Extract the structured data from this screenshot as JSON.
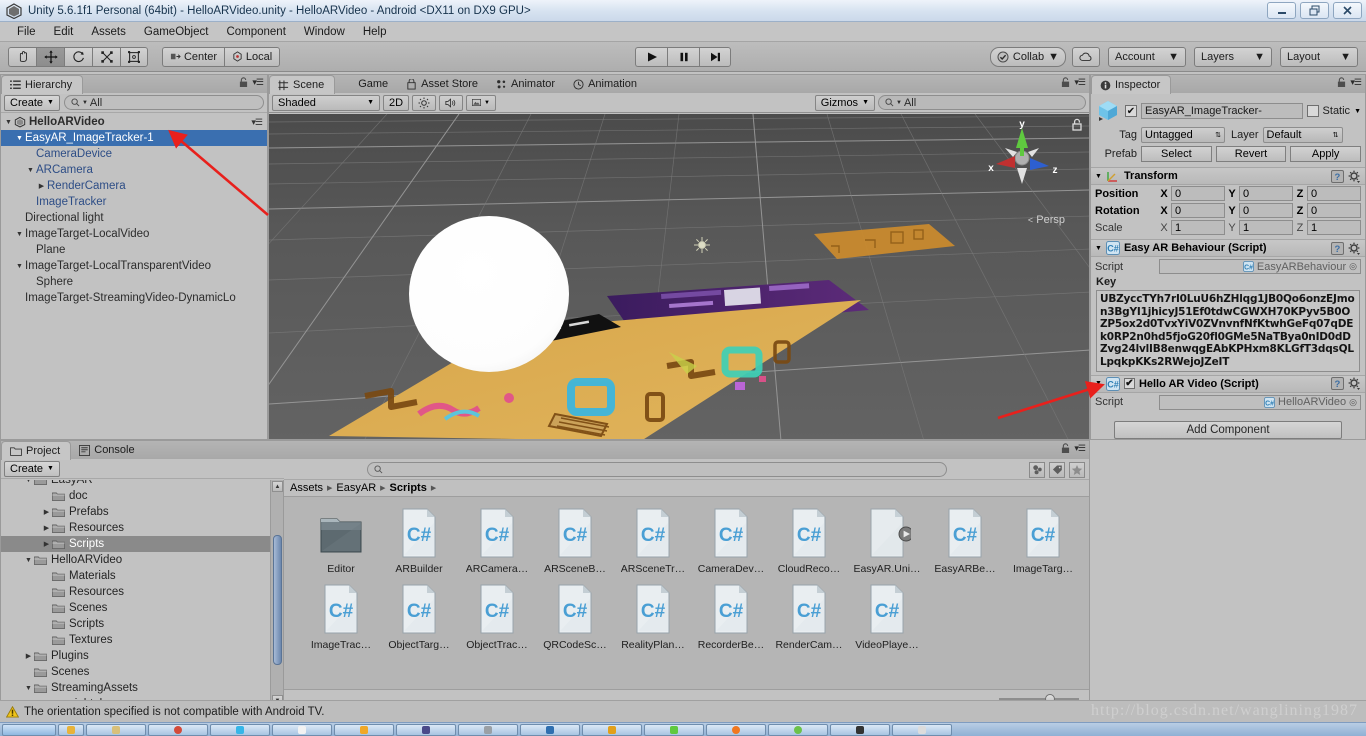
{
  "window": {
    "title": "Unity 5.6.1f1 Personal (64bit) - HelloARVideo.unity - HelloARVideo - Android <DX11 on DX9 GPU>",
    "app_icon": "unity-logo-icon",
    "minimize": "–",
    "restore": "❐",
    "close": "✕"
  },
  "menubar": {
    "items": [
      "File",
      "Edit",
      "Assets",
      "GameObject",
      "Component",
      "Window",
      "Help"
    ]
  },
  "toolbar": {
    "tools": [
      {
        "name": "hand-tool",
        "glyph": "✋",
        "active": false
      },
      {
        "name": "move-tool",
        "glyph": "✥",
        "active": true
      },
      {
        "name": "rotate-tool",
        "glyph": "↻",
        "active": false
      },
      {
        "name": "scale-tool",
        "glyph": "⤢",
        "active": false
      },
      {
        "name": "rect-tool",
        "glyph": "⧉",
        "active": false
      }
    ],
    "pivot_mode": "Center",
    "pivot_rotation": "Local",
    "play": "▶",
    "pause": "❙❙",
    "step": "▶❙",
    "collab": "Collab",
    "cloud_icon": "cloud-icon",
    "account": "Account",
    "layers": "Layers",
    "layout": "Layout"
  },
  "hierarchy": {
    "tab": "Hierarchy",
    "tab_icon": "hierarchy-icon",
    "create": "Create",
    "search_placeholder": "All",
    "search_value": "",
    "rows": [
      {
        "label": "HelloARVideo",
        "depth": 0,
        "arrow": "down",
        "scene": true,
        "selected": false,
        "style": "bold"
      },
      {
        "label": "EasyAR_ImageTracker-1",
        "depth": 1,
        "arrow": "down",
        "scene": false,
        "selected": true,
        "style": "prefab"
      },
      {
        "label": "CameraDevice",
        "depth": 2,
        "arrow": "none",
        "scene": false,
        "selected": false,
        "style": "prefab"
      },
      {
        "label": "ARCamera",
        "depth": 2,
        "arrow": "down",
        "scene": false,
        "selected": false,
        "style": "prefab"
      },
      {
        "label": "RenderCamera",
        "depth": 3,
        "arrow": "right",
        "scene": false,
        "selected": false,
        "style": "prefab"
      },
      {
        "label": "ImageTracker",
        "depth": 2,
        "arrow": "none",
        "scene": false,
        "selected": false,
        "style": "prefab"
      },
      {
        "label": "Directional light",
        "depth": 1,
        "arrow": "none",
        "scene": false,
        "selected": false,
        "style": "normal"
      },
      {
        "label": "ImageTarget-LocalVideo",
        "depth": 1,
        "arrow": "down",
        "scene": false,
        "selected": false,
        "style": "normal"
      },
      {
        "label": "Plane",
        "depth": 2,
        "arrow": "none",
        "scene": false,
        "selected": false,
        "style": "normal"
      },
      {
        "label": "ImageTarget-LocalTransparentVideo",
        "depth": 1,
        "arrow": "down",
        "scene": false,
        "selected": false,
        "style": "normal"
      },
      {
        "label": "Sphere",
        "depth": 2,
        "arrow": "none",
        "scene": false,
        "selected": false,
        "style": "normal"
      },
      {
        "label": "ImageTarget-StreamingVideo-DynamicLo",
        "depth": 1,
        "arrow": "none",
        "scene": false,
        "selected": false,
        "style": "normal"
      }
    ]
  },
  "scene": {
    "tabs": [
      {
        "label": "Scene",
        "icon": "grid-icon",
        "active": true
      },
      {
        "label": "Game",
        "icon": "gamepad-icon",
        "active": false
      },
      {
        "label": "Asset Store",
        "icon": "store-icon",
        "active": false
      },
      {
        "label": "Animator",
        "icon": "animator-icon",
        "active": false
      },
      {
        "label": "Animation",
        "icon": "clock-icon",
        "active": false
      }
    ],
    "draw_mode": "Shaded",
    "mode_2d": "2D",
    "lighting_icon": "sun-icon",
    "audio_icon": "speaker-icon",
    "effects_icon": "image-icon",
    "gizmos": "Gizmos",
    "gizmo_search_placeholder": "All",
    "gizmo_search_value": "",
    "axis_labels": {
      "x": "x",
      "y": "y",
      "z": "z"
    },
    "projection": "Persp",
    "lock_icon": "lock-icon"
  },
  "inspector": {
    "tab": "Inspector",
    "tab_icon": "info-icon",
    "object_icon": "prefab-cube-icon",
    "enabled": true,
    "name_value": "EasyAR_ImageTracker-",
    "static_label": "Static",
    "static_checked": false,
    "tag_label": "Tag",
    "tag_value": "Untagged",
    "layer_label": "Layer",
    "layer_value": "Default",
    "prefab_label": "Prefab",
    "prefab_buttons": [
      "Select",
      "Revert",
      "Apply"
    ],
    "transform": {
      "title": "Transform",
      "icon": "transform-icon",
      "rows": [
        {
          "name": "Position",
          "bold": true,
          "x": "0",
          "y": "0",
          "z": "0"
        },
        {
          "name": "Rotation",
          "bold": true,
          "x": "0",
          "y": "0",
          "z": "0"
        },
        {
          "name": "Scale",
          "bold": false,
          "x": "1",
          "y": "1",
          "z": "1"
        }
      ]
    },
    "easyar_behaviour": {
      "title": "Easy AR Behaviour (Script)",
      "icon": "csharp-script-icon",
      "script_label": "Script",
      "script_value": "EasyARBehaviour",
      "key_label": "Key",
      "key_value": "UBZyccTYh7rI0LuU6hZHlqg1JB0Qo6onzEJmon3BgYI1jhicyJ51Ef0tdwCGWXH70KPyv5B0OZP5ox2d0TvxYiV0ZVnvnfNfKtwhGeFq07qDEk0RP2n0hd5fjoG20fl0GMe5NaTBya0nID0dDZvg24lvlIB8enwqgEAbKPHxm8KLGfT3dqsQLLpqkpKKs2RWejoJZeIT"
    },
    "hello_ar_video": {
      "title": "Hello AR Video (Script)",
      "icon": "csharp-script-icon",
      "enabled": true,
      "script_label": "Script",
      "script_value": "HelloARVideo"
    },
    "add_component": "Add Component"
  },
  "project": {
    "tabs": [
      {
        "label": "Project",
        "icon": "folder-icon",
        "active": true
      },
      {
        "label": "Console",
        "icon": "console-icon",
        "active": false
      }
    ],
    "create": "Create",
    "search_placeholder": "",
    "search_value": "",
    "filter_icons": [
      "object-filter-icon",
      "label-filter-icon",
      "favorite-filter-icon"
    ],
    "tree": [
      {
        "label": "EasyAR",
        "depth": 1,
        "arrow": "down",
        "selected": false,
        "clipped": true
      },
      {
        "label": "doc",
        "depth": 2,
        "arrow": "none",
        "selected": false
      },
      {
        "label": "Prefabs",
        "depth": 2,
        "arrow": "right",
        "selected": false
      },
      {
        "label": "Resources",
        "depth": 2,
        "arrow": "right",
        "selected": false
      },
      {
        "label": "Scripts",
        "depth": 2,
        "arrow": "right",
        "selected": true
      },
      {
        "label": "HelloARVideo",
        "depth": 1,
        "arrow": "down",
        "selected": false
      },
      {
        "label": "Materials",
        "depth": 2,
        "arrow": "none",
        "selected": false
      },
      {
        "label": "Resources",
        "depth": 2,
        "arrow": "none",
        "selected": false
      },
      {
        "label": "Scenes",
        "depth": 2,
        "arrow": "none",
        "selected": false
      },
      {
        "label": "Scripts",
        "depth": 2,
        "arrow": "none",
        "selected": false
      },
      {
        "label": "Textures",
        "depth": 2,
        "arrow": "none",
        "selected": false
      },
      {
        "label": "Plugins",
        "depth": 1,
        "arrow": "right",
        "selected": false
      },
      {
        "label": "Scenes",
        "depth": 1,
        "arrow": "none",
        "selected": false
      },
      {
        "label": "StreamingAssets",
        "depth": 1,
        "arrow": "down",
        "selected": false
      },
      {
        "label": "sightplus",
        "depth": 2,
        "arrow": "none",
        "selected": false
      }
    ],
    "breadcrumb": [
      "Assets",
      "EasyAR",
      "Scripts"
    ],
    "breadcrumb_current": "Scripts",
    "assets": [
      {
        "label": "Editor",
        "type": "folder"
      },
      {
        "label": "ARBuilder",
        "type": "csharp"
      },
      {
        "label": "ARCamera…",
        "type": "csharp"
      },
      {
        "label": "ARSceneB…",
        "type": "csharp"
      },
      {
        "label": "ARSceneTr…",
        "type": "csharp"
      },
      {
        "label": "CameraDev…",
        "type": "csharp"
      },
      {
        "label": "CloudReco…",
        "type": "csharp"
      },
      {
        "label": "EasyAR.Uni…",
        "type": "dll"
      },
      {
        "label": "EasyARBe…",
        "type": "csharp"
      },
      {
        "label": "ImageTarg…",
        "type": "csharp"
      },
      {
        "label": "ImageTrac…",
        "type": "csharp"
      },
      {
        "label": "ObjectTarg…",
        "type": "csharp"
      },
      {
        "label": "ObjectTrac…",
        "type": "csharp"
      },
      {
        "label": "QRCodeSc…",
        "type": "csharp"
      },
      {
        "label": "RealityPlan…",
        "type": "csharp"
      },
      {
        "label": "RecorderBe…",
        "type": "csharp"
      },
      {
        "label": "RenderCam…",
        "type": "csharp"
      },
      {
        "label": "VideoPlaye…",
        "type": "csharp"
      }
    ]
  },
  "status": {
    "icon": "warning-icon",
    "message": "The orientation specified is not compatible with Android TV."
  },
  "watermark": "http://blog.csdn.net/wanglining1987",
  "colors": {
    "selection_blue": "#3a6fb0",
    "panel_gray": "#c2c2c2",
    "scene_bg": "#5c5c5c",
    "accent_red": "#e8201c",
    "csharp_blue": "#4a9fd4",
    "axis_x": "#c03030",
    "axis_y": "#5fc93f",
    "axis_z": "#2d5fd0"
  }
}
